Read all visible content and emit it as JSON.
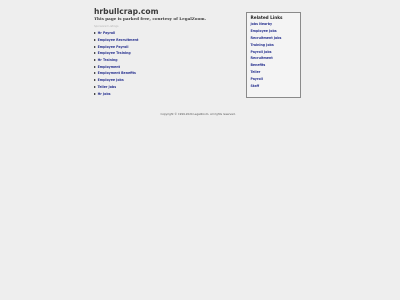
{
  "header": {
    "domain": "hrbullcrap.com",
    "tagline": "This page is parked free, courtesy of LegalZoom."
  },
  "sponsored": {
    "caption": "Sponsored Listings",
    "items": [
      {
        "label": "Hr Payroll"
      },
      {
        "label": "Employee Recruitment"
      },
      {
        "label": "Employee Payroll"
      },
      {
        "label": "Employee Training"
      },
      {
        "label": "Hr Training"
      },
      {
        "label": "Employment"
      },
      {
        "label": "Employment Benefits"
      },
      {
        "label": "Employee Jobs"
      },
      {
        "label": "Teller Jobs"
      },
      {
        "label": "Hr Jobs"
      }
    ]
  },
  "related": {
    "title": "Related Links",
    "items": [
      {
        "label": "Jobs Nearby"
      },
      {
        "label": "Employee Jobs"
      },
      {
        "label": "Recruitment Jobs"
      },
      {
        "label": "Training Jobs"
      },
      {
        "label": "Payroll Jobs"
      },
      {
        "label": "Recruitment"
      },
      {
        "label": "Benefits"
      },
      {
        "label": "Teller"
      },
      {
        "label": "Payroll"
      },
      {
        "label": "Staff"
      }
    ]
  },
  "footer": {
    "copyright": "Copyright © 1999-2024 LegalZoom. All rights reserved."
  },
  "colors": {
    "link": "#27318f",
    "heading": "#3a3a3a",
    "box_border": "#8a8a8a",
    "box_background": "#f4f4f4"
  },
  "icons": {
    "list_marker": "triangle-right-icon"
  }
}
